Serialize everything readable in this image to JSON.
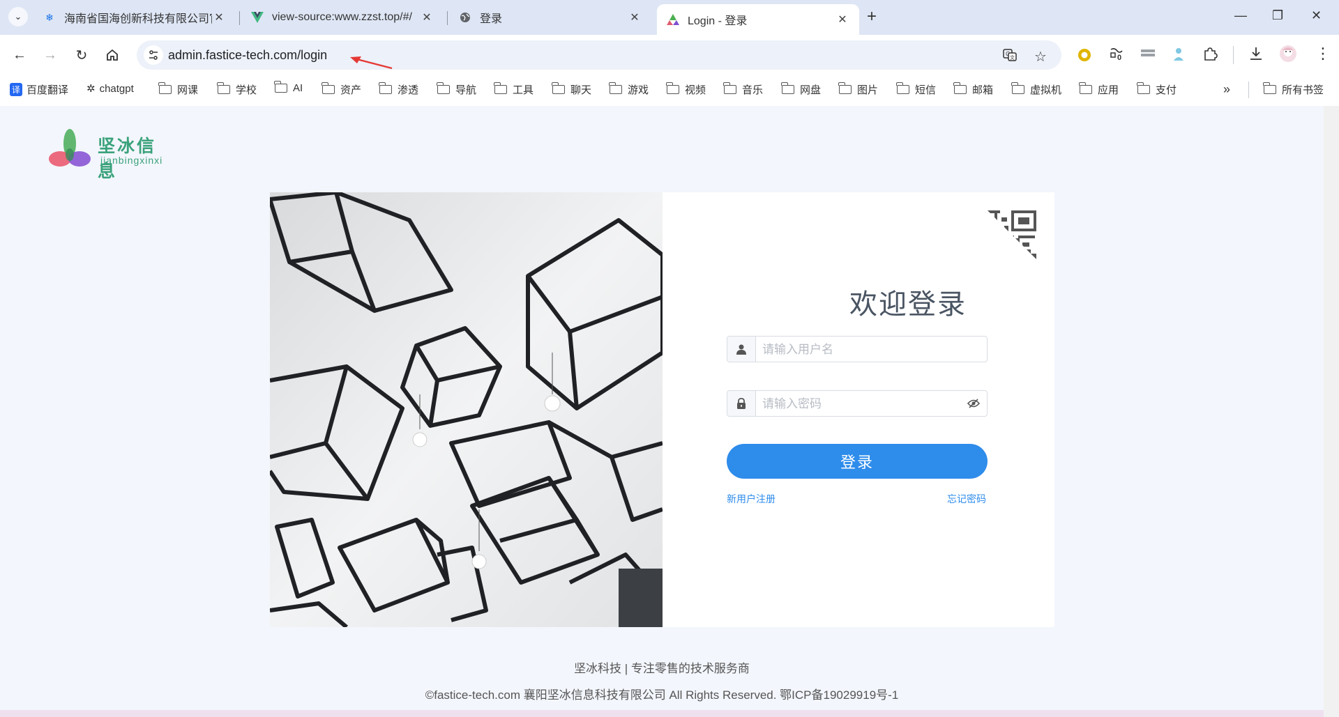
{
  "browser": {
    "tabs": [
      {
        "title": "海南省国海创新科技有限公司官",
        "favicon": "snowflake-icon",
        "active": false
      },
      {
        "title": "view-source:www.zzst.top/#/",
        "favicon": "vue-icon",
        "active": false
      },
      {
        "title": "登录",
        "favicon": "globe-icon",
        "active": false
      },
      {
        "title": "Login - 登录",
        "favicon": "triangle-logo-icon",
        "active": true
      }
    ],
    "url": "admin.fastice-tech.com/login",
    "extension_badge": "0",
    "bookmarks": [
      {
        "label": "百度翻译",
        "icon": "translate-icon"
      },
      {
        "label": "chatgpt",
        "icon": "openai-icon"
      },
      {
        "label": "网课",
        "icon": "folder-icon"
      },
      {
        "label": "学校",
        "icon": "folder-icon"
      },
      {
        "label": "AI",
        "icon": "folder-icon"
      },
      {
        "label": "资产",
        "icon": "folder-icon"
      },
      {
        "label": "渗透",
        "icon": "folder-icon"
      },
      {
        "label": "导航",
        "icon": "folder-icon"
      },
      {
        "label": "工具",
        "icon": "folder-icon"
      },
      {
        "label": "聊天",
        "icon": "folder-icon"
      },
      {
        "label": "游戏",
        "icon": "folder-icon"
      },
      {
        "label": "视频",
        "icon": "folder-icon"
      },
      {
        "label": "音乐",
        "icon": "folder-icon"
      },
      {
        "label": "网盘",
        "icon": "folder-icon"
      },
      {
        "label": "图片",
        "icon": "folder-icon"
      },
      {
        "label": "短信",
        "icon": "folder-icon"
      },
      {
        "label": "邮箱",
        "icon": "folder-icon"
      },
      {
        "label": "虚拟机",
        "icon": "folder-icon"
      },
      {
        "label": "应用",
        "icon": "folder-icon"
      },
      {
        "label": "支付",
        "icon": "folder-icon"
      }
    ],
    "all_bookmarks": "所有书签"
  },
  "logo": {
    "cn": "坚冰信息",
    "pinyin": "jianbingxinxi"
  },
  "login": {
    "title": "欢迎登录",
    "username_placeholder": "请输入用户名",
    "password_placeholder": "请输入密码",
    "submit_label": "登录",
    "register_link": "新用户注册",
    "forgot_link": "忘记密码"
  },
  "footer": {
    "tagline": "坚冰科技 | 专注零售的技术服务商",
    "copyright": "©fastice-tech.com 襄阳坚冰信息科技有限公司 All Rights Reserved. 鄂ICP备19029919号-1"
  },
  "colors": {
    "accent": "#2e8ceb",
    "logo_green": "#3aa27b",
    "page_bg": "#f3f6fc"
  }
}
